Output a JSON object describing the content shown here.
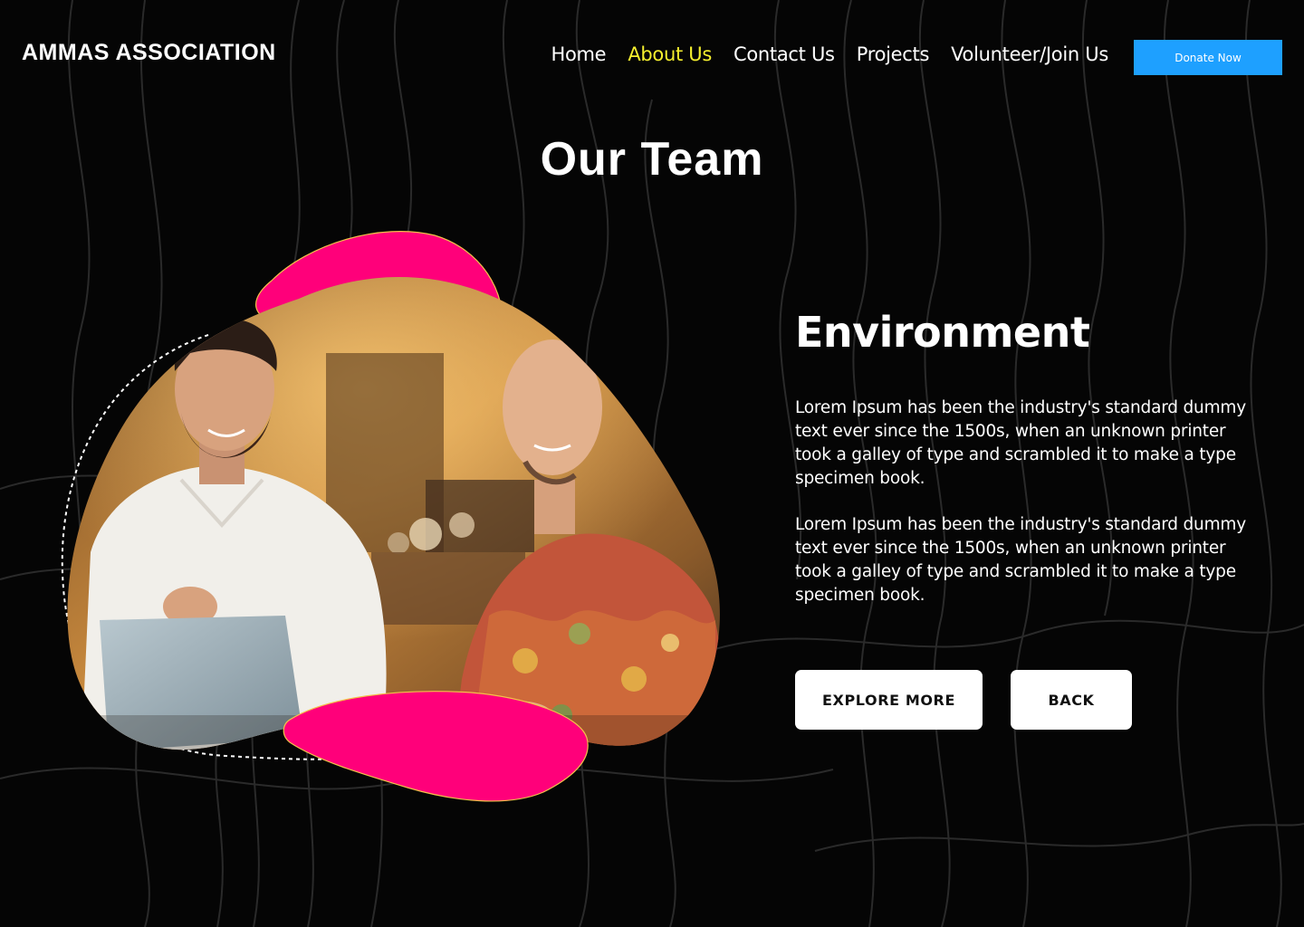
{
  "header": {
    "brand": "AMMAS ASSOCIATION",
    "nav": [
      {
        "label": "Home",
        "active": false
      },
      {
        "label": "About Us",
        "active": true
      },
      {
        "label": "Contact Us",
        "active": false
      },
      {
        "label": "Projects",
        "active": false
      },
      {
        "label": "Volunteer/Join Us",
        "active": false
      }
    ],
    "donate_label": "Donate Now"
  },
  "main": {
    "title": "Our Team",
    "section_title": "Environment",
    "paragraphs": [
      "Lorem Ipsum has been the industry's standard dummy text ever since the 1500s, when an unknown printer took a galley of type and scrambled it to make a type specimen book.",
      "Lorem Ipsum has been the industry's standard dummy text ever since the 1500s, when an unknown printer took a galley of type and scrambled it to make a type specimen book."
    ],
    "buttons": {
      "explore": "EXPLORE MORE",
      "back": "BACK"
    }
  },
  "colors": {
    "background": "#050505",
    "accent_yellow": "#f5ef2e",
    "accent_blue": "#1ea0ff",
    "accent_pink": "#ff007a"
  }
}
